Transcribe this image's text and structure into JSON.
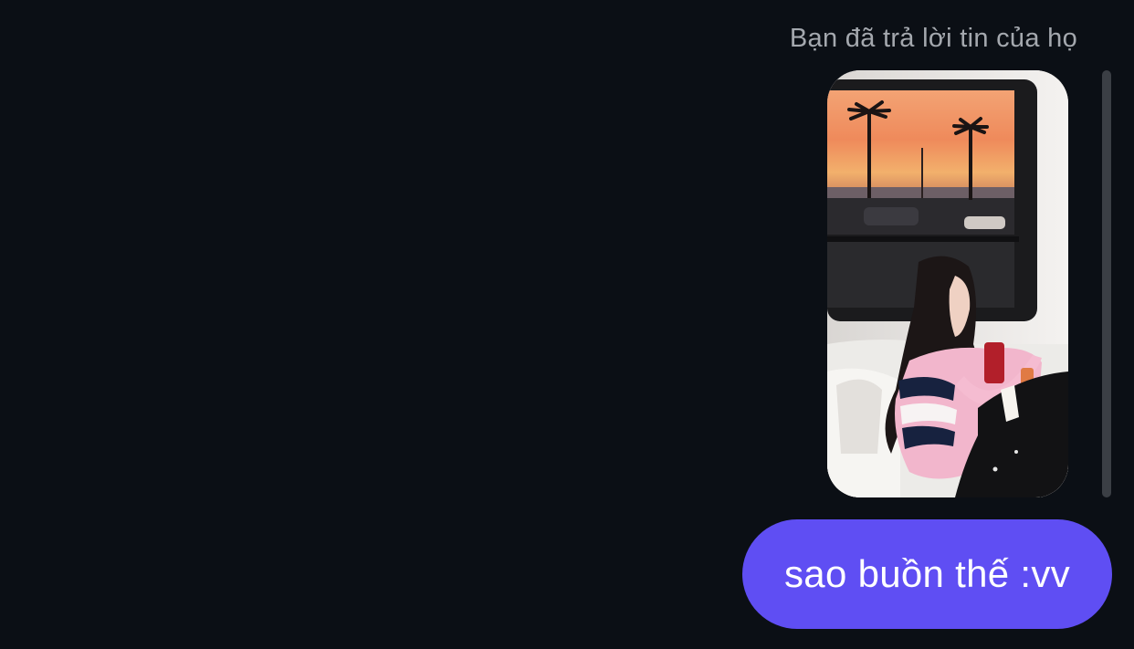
{
  "reply_context": {
    "caption": "Bạn đã trả lời tin của họ"
  },
  "message": {
    "text": "sao buồn thế :vv",
    "bubble_color": "#5f4ef3"
  },
  "story_image": {
    "alt": "replied-story-photo"
  },
  "colors": {
    "background": "#0b0f15",
    "caption": "#a4a8ae",
    "reply_bar": "#3b3f45"
  }
}
